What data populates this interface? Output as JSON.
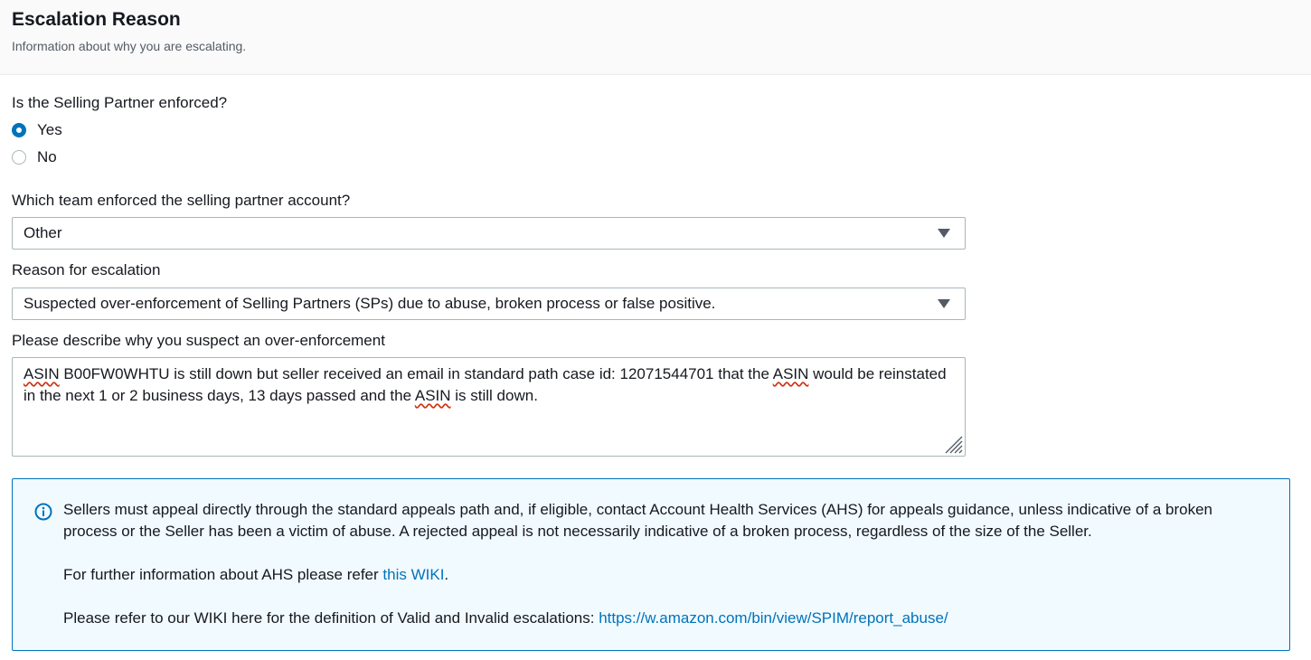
{
  "header": {
    "title": "Escalation Reason",
    "description": "Information about why you are escalating."
  },
  "enforced": {
    "question": "Is the Selling Partner enforced?",
    "options": [
      {
        "label": "Yes",
        "checked": true
      },
      {
        "label": "No",
        "checked": false
      }
    ]
  },
  "team": {
    "label": "Which team enforced the selling partner account?",
    "selected": "Other",
    "icon": "caret-down-icon"
  },
  "reason": {
    "label": "Reason for escalation",
    "selected": "Suspected over-enforcement of Selling Partners (SPs) due to abuse, broken process or false positive.",
    "icon": "caret-down-icon"
  },
  "description": {
    "label": "Please describe why you suspect an over-enforcement",
    "value_parts": [
      "ASIN",
      " B00FW0WHTU is still down but seller received an email in standard path case id: 12071544701 that the ",
      "ASIN",
      " would be reinstated in the next 1 or 2 business days, 13 days passed and the ",
      "ASIN",
      " is still down."
    ]
  },
  "info": {
    "icon": "info-circle-icon",
    "paragraph1": "Sellers must appeal directly through the standard appeals path and, if eligible, contact Account Health Services (AHS) for appeals guidance, unless indicative of a broken process or the Seller has been a victim of abuse. A rejected appeal is not necessarily indicative of a broken process, regardless of the size of the Seller.",
    "paragraph2_prefix": "For further information about AHS please refer ",
    "paragraph2_link": "this WIKI",
    "paragraph2_suffix": ".",
    "paragraph3_prefix": "Please refer to our WIKI here for the definition of Valid and Invalid escalations: ",
    "paragraph3_link": "https://w.amazon.com/bin/view/SPIM/report_abuse/"
  },
  "colors": {
    "accent": "#0073bb",
    "info_background": "#f1faff",
    "spellcheck": "#d13212"
  }
}
